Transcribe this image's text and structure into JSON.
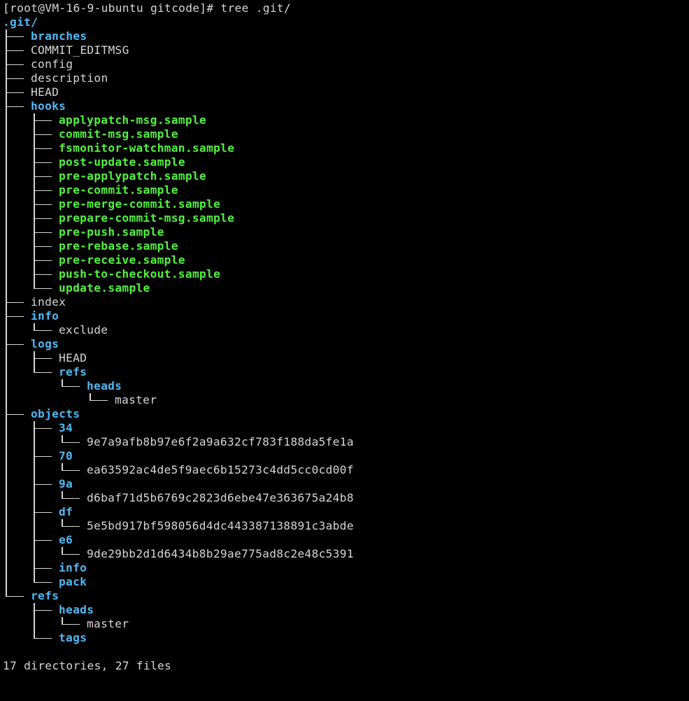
{
  "terminal": {
    "prompt": "[root@VM-16-9-ubuntu gitcode]# tree .git/",
    "root": ".git/",
    "summary": "17 directories, 27 files",
    "colors": {
      "background": "#000000",
      "text": "#d6d6d6",
      "directory": "#52b8f0",
      "executable": "#54f041"
    }
  },
  "tree": [
    {
      "depth": 0,
      "ancestors_continue": [],
      "last": false,
      "kind": "dir",
      "name": "branches"
    },
    {
      "depth": 0,
      "ancestors_continue": [],
      "last": false,
      "kind": "file",
      "name": "COMMIT_EDITMSG"
    },
    {
      "depth": 0,
      "ancestors_continue": [],
      "last": false,
      "kind": "file",
      "name": "config"
    },
    {
      "depth": 0,
      "ancestors_continue": [],
      "last": false,
      "kind": "file",
      "name": "description"
    },
    {
      "depth": 0,
      "ancestors_continue": [],
      "last": false,
      "kind": "file",
      "name": "HEAD"
    },
    {
      "depth": 0,
      "ancestors_continue": [],
      "last": false,
      "kind": "dir",
      "name": "hooks"
    },
    {
      "depth": 1,
      "ancestors_continue": [
        true
      ],
      "last": false,
      "kind": "exe",
      "name": "applypatch-msg.sample"
    },
    {
      "depth": 1,
      "ancestors_continue": [
        true
      ],
      "last": false,
      "kind": "exe",
      "name": "commit-msg.sample"
    },
    {
      "depth": 1,
      "ancestors_continue": [
        true
      ],
      "last": false,
      "kind": "exe",
      "name": "fsmonitor-watchman.sample"
    },
    {
      "depth": 1,
      "ancestors_continue": [
        true
      ],
      "last": false,
      "kind": "exe",
      "name": "post-update.sample"
    },
    {
      "depth": 1,
      "ancestors_continue": [
        true
      ],
      "last": false,
      "kind": "exe",
      "name": "pre-applypatch.sample"
    },
    {
      "depth": 1,
      "ancestors_continue": [
        true
      ],
      "last": false,
      "kind": "exe",
      "name": "pre-commit.sample"
    },
    {
      "depth": 1,
      "ancestors_continue": [
        true
      ],
      "last": false,
      "kind": "exe",
      "name": "pre-merge-commit.sample"
    },
    {
      "depth": 1,
      "ancestors_continue": [
        true
      ],
      "last": false,
      "kind": "exe",
      "name": "prepare-commit-msg.sample"
    },
    {
      "depth": 1,
      "ancestors_continue": [
        true
      ],
      "last": false,
      "kind": "exe",
      "name": "pre-push.sample"
    },
    {
      "depth": 1,
      "ancestors_continue": [
        true
      ],
      "last": false,
      "kind": "exe",
      "name": "pre-rebase.sample"
    },
    {
      "depth": 1,
      "ancestors_continue": [
        true
      ],
      "last": false,
      "kind": "exe",
      "name": "pre-receive.sample"
    },
    {
      "depth": 1,
      "ancestors_continue": [
        true
      ],
      "last": false,
      "kind": "exe",
      "name": "push-to-checkout.sample"
    },
    {
      "depth": 1,
      "ancestors_continue": [
        true
      ],
      "last": true,
      "kind": "exe",
      "name": "update.sample"
    },
    {
      "depth": 0,
      "ancestors_continue": [],
      "last": false,
      "kind": "file",
      "name": "index"
    },
    {
      "depth": 0,
      "ancestors_continue": [],
      "last": false,
      "kind": "dir",
      "name": "info"
    },
    {
      "depth": 1,
      "ancestors_continue": [
        true
      ],
      "last": true,
      "kind": "file",
      "name": "exclude"
    },
    {
      "depth": 0,
      "ancestors_continue": [],
      "last": false,
      "kind": "dir",
      "name": "logs"
    },
    {
      "depth": 1,
      "ancestors_continue": [
        true
      ],
      "last": false,
      "kind": "file",
      "name": "HEAD"
    },
    {
      "depth": 1,
      "ancestors_continue": [
        true
      ],
      "last": true,
      "kind": "dir",
      "name": "refs"
    },
    {
      "depth": 2,
      "ancestors_continue": [
        true,
        false
      ],
      "last": true,
      "kind": "dir",
      "name": "heads"
    },
    {
      "depth": 3,
      "ancestors_continue": [
        true,
        false,
        false
      ],
      "last": true,
      "kind": "file",
      "name": "master"
    },
    {
      "depth": 0,
      "ancestors_continue": [],
      "last": false,
      "kind": "dir",
      "name": "objects"
    },
    {
      "depth": 1,
      "ancestors_continue": [
        true
      ],
      "last": false,
      "kind": "dir",
      "name": "34"
    },
    {
      "depth": 2,
      "ancestors_continue": [
        true,
        true
      ],
      "last": true,
      "kind": "file",
      "name": "9e7a9afb8b97e6f2a9a632cf783f188da5fe1a"
    },
    {
      "depth": 1,
      "ancestors_continue": [
        true
      ],
      "last": false,
      "kind": "dir",
      "name": "70"
    },
    {
      "depth": 2,
      "ancestors_continue": [
        true,
        true
      ],
      "last": true,
      "kind": "file",
      "name": "ea63592ac4de5f9aec6b15273c4dd5cc0cd00f"
    },
    {
      "depth": 1,
      "ancestors_continue": [
        true
      ],
      "last": false,
      "kind": "dir",
      "name": "9a"
    },
    {
      "depth": 2,
      "ancestors_continue": [
        true,
        true
      ],
      "last": true,
      "kind": "file",
      "name": "d6baf71d5b6769c2823d6ebe47e363675a24b8"
    },
    {
      "depth": 1,
      "ancestors_continue": [
        true
      ],
      "last": false,
      "kind": "dir",
      "name": "df"
    },
    {
      "depth": 2,
      "ancestors_continue": [
        true,
        true
      ],
      "last": true,
      "kind": "file",
      "name": "5e5bd917bf598056d4dc443387138891c3abde"
    },
    {
      "depth": 1,
      "ancestors_continue": [
        true
      ],
      "last": false,
      "kind": "dir",
      "name": "e6"
    },
    {
      "depth": 2,
      "ancestors_continue": [
        true,
        true
      ],
      "last": true,
      "kind": "file",
      "name": "9de29bb2d1d6434b8b29ae775ad8c2e48c5391"
    },
    {
      "depth": 1,
      "ancestors_continue": [
        true
      ],
      "last": false,
      "kind": "dir",
      "name": "info"
    },
    {
      "depth": 1,
      "ancestors_continue": [
        true
      ],
      "last": true,
      "kind": "dir",
      "name": "pack"
    },
    {
      "depth": 0,
      "ancestors_continue": [],
      "last": true,
      "kind": "dir",
      "name": "refs"
    },
    {
      "depth": 1,
      "ancestors_continue": [
        false
      ],
      "last": false,
      "kind": "dir",
      "name": "heads"
    },
    {
      "depth": 2,
      "ancestors_continue": [
        false,
        true
      ],
      "last": true,
      "kind": "file",
      "name": "master"
    },
    {
      "depth": 1,
      "ancestors_continue": [
        false
      ],
      "last": true,
      "kind": "dir",
      "name": "tags"
    }
  ]
}
